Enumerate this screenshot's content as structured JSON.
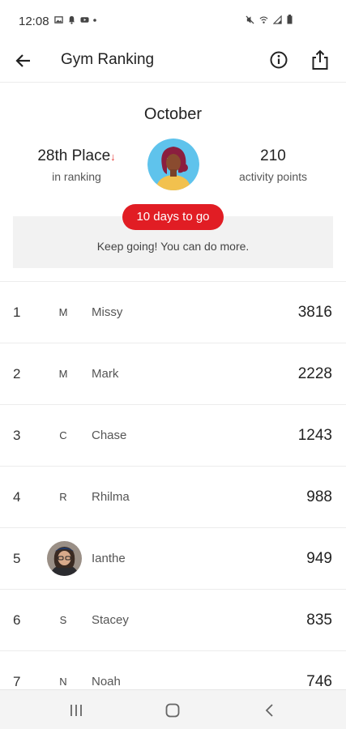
{
  "status_bar": {
    "time": "12:08",
    "left_icons": [
      "image-icon",
      "bell-icon",
      "youtube-icon",
      "dot-icon"
    ],
    "right_icons": [
      "mute-icon",
      "wifi-icon",
      "signal-icon",
      "battery-icon"
    ]
  },
  "app_bar": {
    "title": "Gym Ranking",
    "back_icon": "arrow-left-icon",
    "info_icon": "info-icon",
    "share_icon": "share-icon"
  },
  "summary": {
    "month": "October",
    "place_value": "28th Place",
    "place_trend": "↓",
    "place_label": "in ranking",
    "points_value": "210",
    "points_label": "activity points",
    "days_left": "10 days to go",
    "encouragement": "Keep going! You can do more."
  },
  "ranking": [
    {
      "rank": "1",
      "initial": "M",
      "name": "Missy",
      "score": "3816"
    },
    {
      "rank": "2",
      "initial": "M",
      "name": "Mark",
      "score": "2228"
    },
    {
      "rank": "3",
      "initial": "C",
      "name": "Chase",
      "score": "1243"
    },
    {
      "rank": "4",
      "initial": "R",
      "name": "Rhilma",
      "score": "988"
    },
    {
      "rank": "5",
      "initial": "",
      "name": "Ianthe",
      "score": "949",
      "has_photo": true
    },
    {
      "rank": "6",
      "initial": "S",
      "name": "Stacey",
      "score": "835"
    },
    {
      "rank": "7",
      "initial": "N",
      "name": "Noah",
      "score": "746"
    }
  ],
  "nav_bar": {
    "icons": [
      "recent-apps-icon",
      "home-icon",
      "back-icon"
    ]
  },
  "colors": {
    "accent": "#e11d24",
    "trend_down": "#e53935",
    "avatar_bg": "#5fc3ec"
  }
}
